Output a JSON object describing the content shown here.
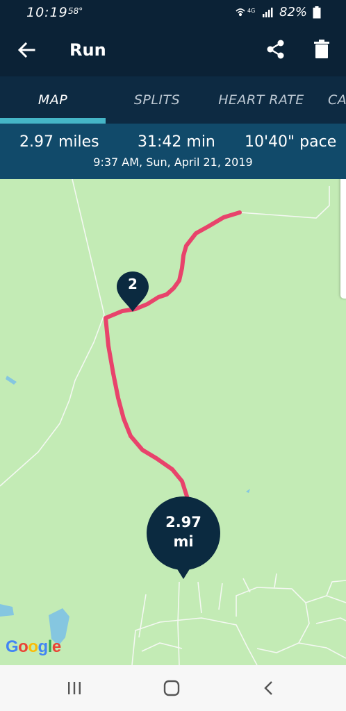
{
  "status_bar": {
    "time": "10:19",
    "temperature": "58°",
    "network": "4G",
    "battery": "82%"
  },
  "app_bar": {
    "title": "Run",
    "icons": [
      "back-arrow-icon",
      "share-icon",
      "trash-icon"
    ]
  },
  "tabs": [
    {
      "label": "MAP",
      "active": true
    },
    {
      "label": "SPLITS",
      "active": false
    },
    {
      "label": "HEART RATE",
      "active": false
    },
    {
      "label": "CA",
      "active": false
    }
  ],
  "stats": {
    "distance": "2.97 miles",
    "duration": "31:42 min",
    "pace": "10'40\" pace",
    "date": "9:37 AM, Sun, April 21, 2019"
  },
  "map": {
    "lap_marker": "2",
    "end_marker_value": "2.97",
    "end_marker_unit": "mi",
    "attribution": "Google",
    "route_color": "#e8436b",
    "marker_color": "#0b2a40",
    "land_color": "#c3ebb5"
  },
  "nav_bar": {
    "icons": [
      "recent-apps-icon",
      "home-icon",
      "back-icon"
    ]
  }
}
